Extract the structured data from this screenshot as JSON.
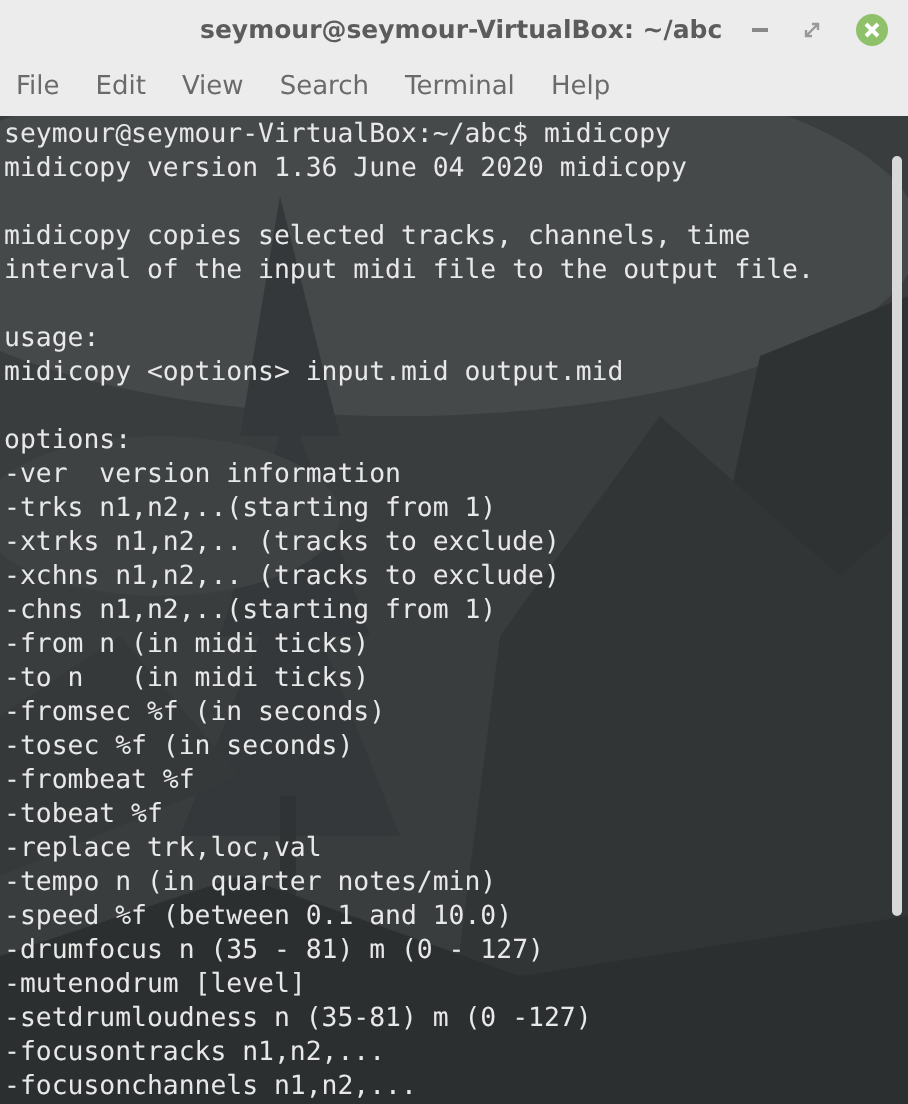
{
  "window": {
    "title": "seymour@seymour-VirtualBox: ~/abc"
  },
  "menu": [
    "File",
    "Edit",
    "View",
    "Search",
    "Terminal",
    "Help"
  ],
  "terminal": {
    "blocks": [
      [
        "seymour@seymour-VirtualBox:~/abc$ midicopy",
        "midicopy version 1.36 June 04 2020 midicopy"
      ],
      [
        "midicopy copies selected tracks, channels, time",
        "interval of the input midi file to the output file."
      ],
      [
        "usage:",
        "midicopy <options> input.mid output.mid"
      ],
      [
        "options:",
        "-ver  version information",
        "-trks n1,n2,..(starting from 1)",
        "-xtrks n1,n2,.. (tracks to exclude)",
        "-xchns n1,n2,.. (tracks to exclude)",
        "-chns n1,n2,..(starting from 1)",
        "-from n (in midi ticks)",
        "-to n   (in midi ticks)",
        "-fromsec %f (in seconds)",
        "-tosec %f (in seconds)",
        "-frombeat %f",
        "-tobeat %f",
        "-replace trk,loc,val",
        "-tempo n (in quarter notes/min)",
        "-speed %f (between 0.1 and 10.0)",
        "-drumfocus n (35 - 81) m (0 - 127)",
        "-mutenodrum [level]",
        "-setdrumloudness n (35-81) m (0 -127)",
        "-focusontracks n1,n2,...",
        "-focusonchannels n1,n2,..."
      ]
    ]
  }
}
